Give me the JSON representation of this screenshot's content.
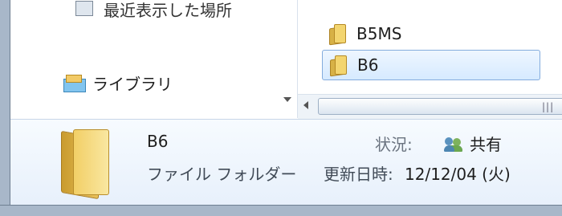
{
  "navigation": {
    "recent_label": "最近表示した場所",
    "library_label": "ライブラリ"
  },
  "files": {
    "items": [
      "B5MS",
      "B6"
    ]
  },
  "details": {
    "name": "B6",
    "type": "ファイル フォルダー",
    "status_label": "状況:",
    "status_value": "共有",
    "modified_label": "更新日時:",
    "modified_value": "12/12/04 (火)"
  },
  "icons": {
    "folder": "folder-icon",
    "library": "library-icon",
    "recent": "recent-places-icon",
    "shared": "shared-users-icon"
  }
}
